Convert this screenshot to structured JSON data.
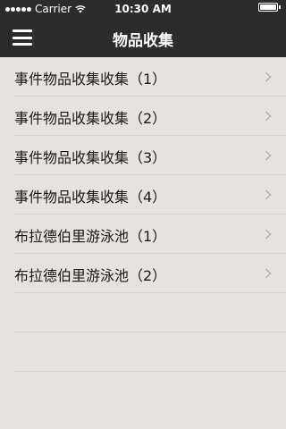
{
  "status_bar": {
    "carrier": "Carrier",
    "time": "10:30 AM",
    "battery_level": 1.0
  },
  "nav": {
    "title": "物品收集",
    "menu_icon": "hamburger-menu-icon"
  },
  "list": {
    "items": [
      {
        "label": "事件物品收集收集（1）"
      },
      {
        "label": "事件物品收集收集（2）"
      },
      {
        "label": "事件物品收集收集（3）"
      },
      {
        "label": "事件物品收集收集（4）"
      },
      {
        "label": "布拉德伯里游泳池（1）"
      },
      {
        "label": "布拉德伯里游泳池（2）"
      }
    ],
    "chevron_icon": "chevron-right-icon"
  },
  "colors": {
    "bar_background": "#2c2c2c",
    "list_background": "#e6e2df",
    "separator": "#d6d2cf",
    "chevron": "#b8b4b1"
  }
}
